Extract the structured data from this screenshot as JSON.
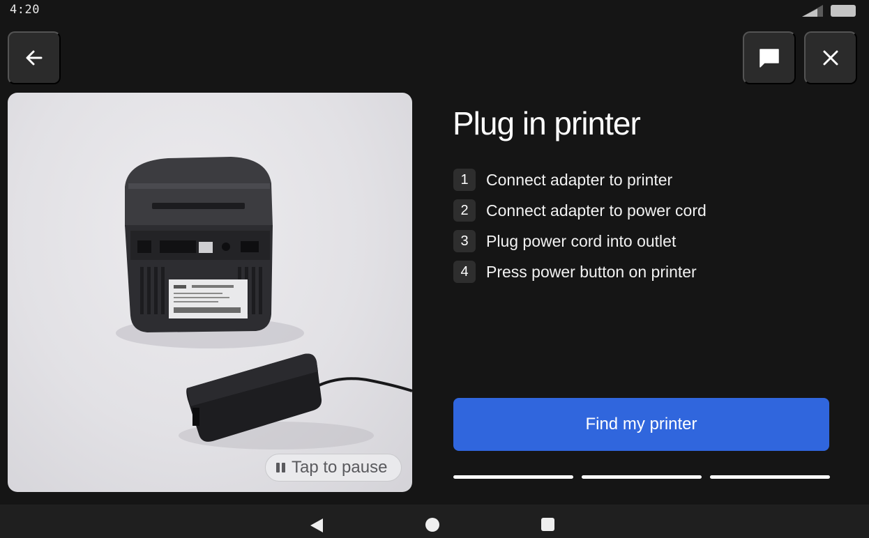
{
  "status_bar": {
    "time": "4:20",
    "signal_icon": "cell-signal-icon",
    "battery_icon": "battery-icon"
  },
  "header": {
    "back_icon": "arrow-left-icon",
    "chat_icon": "chat-bubble-icon",
    "close_icon": "close-icon"
  },
  "media": {
    "pause_label": "Tap to pause",
    "pause_icon": "pause-icon",
    "printer_label": "Label Printer"
  },
  "content": {
    "title": "Plug in printer",
    "steps": [
      {
        "number": "1",
        "text": "Connect adapter to printer"
      },
      {
        "number": "2",
        "text": "Connect adapter to power cord"
      },
      {
        "number": "3",
        "text": "Plug power cord into outlet"
      },
      {
        "number": "4",
        "text": "Press power button on printer"
      }
    ],
    "primary_button": "Find my printer",
    "progress_segments_total": 3,
    "progress_segments_complete": 3
  },
  "nav_bar": {
    "back_icon": "triangle-back-icon",
    "home_icon": "circle-home-icon",
    "recents_icon": "square-recents-icon"
  },
  "colors": {
    "background": "#151515",
    "button_surface": "#2b2b2b",
    "accent": "#3066dd",
    "text": "#ffffff"
  }
}
